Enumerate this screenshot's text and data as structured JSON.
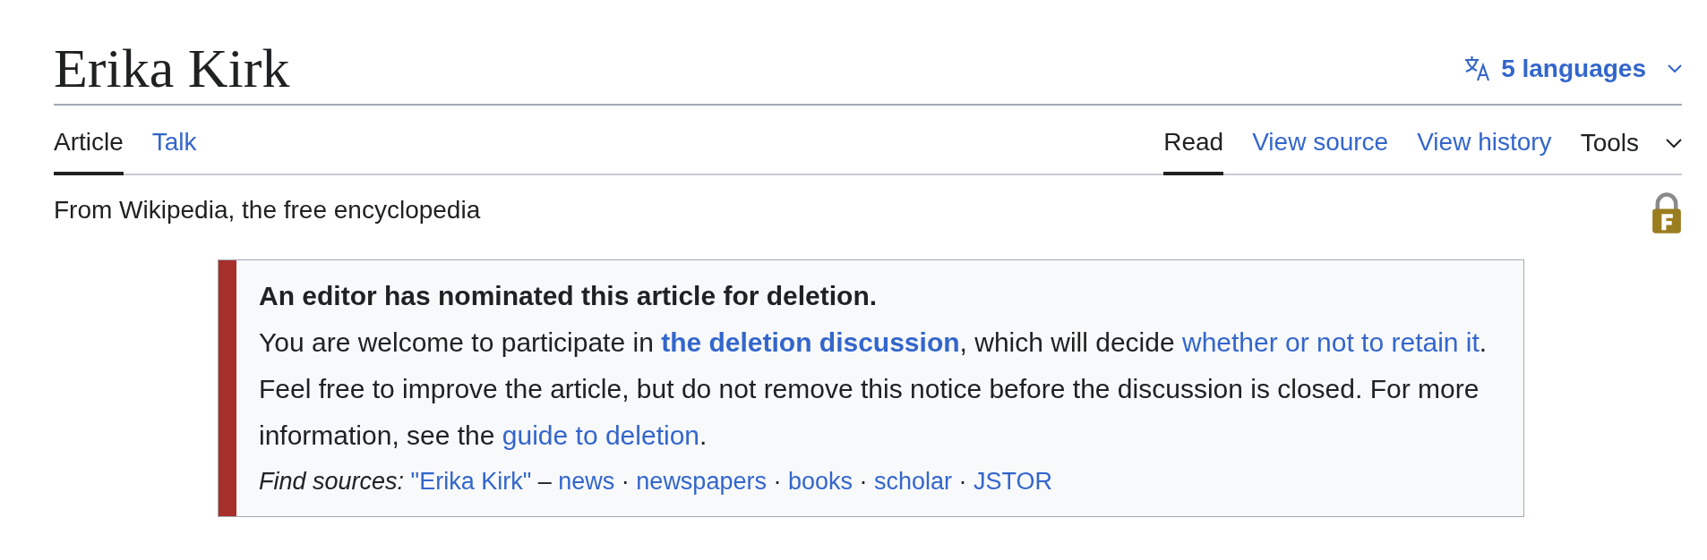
{
  "page": {
    "title": "Erika Kirk",
    "languages": {
      "label": "5 languages"
    }
  },
  "tabs_left": [
    {
      "label": "Article",
      "selected": true
    },
    {
      "label": "Talk",
      "selected": false
    }
  ],
  "tabs_right": [
    {
      "label": "Read",
      "selected": true
    },
    {
      "label": "View source",
      "selected": false
    },
    {
      "label": "View history",
      "selected": false
    }
  ],
  "tools": {
    "label": "Tools"
  },
  "tagline": "From Wikipedia, the free encyclopedia",
  "notice": {
    "heading": "An editor has nominated this article for deletion.",
    "paragraphs": [
      [
        {
          "text": "You are welcome to participate in ",
          "kind": "text"
        },
        {
          "text": "the deletion discussion",
          "kind": "strong_link"
        },
        {
          "text": ", which will decide ",
          "kind": "text"
        },
        {
          "text": "whether or not to",
          "kind": "link"
        },
        {
          "text": "retain it",
          "kind": "link"
        },
        {
          "text": ".",
          "kind": "text"
        }
      ],
      [
        {
          "text": "Feel free to improve the article, but do not remove this notice before the discussion is closed. For more information, see the ",
          "kind": "text"
        },
        {
          "text": "guide to deletion",
          "kind": "link"
        },
        {
          "text": ".",
          "kind": "text"
        }
      ]
    ],
    "find_sources": {
      "label": "Find sources:",
      "query": "\"Erika Kirk\"",
      "dash": "–",
      "separator": "·",
      "links": [
        "news",
        "newspapers",
        "books",
        "scholar",
        "JSTOR"
      ]
    }
  }
}
